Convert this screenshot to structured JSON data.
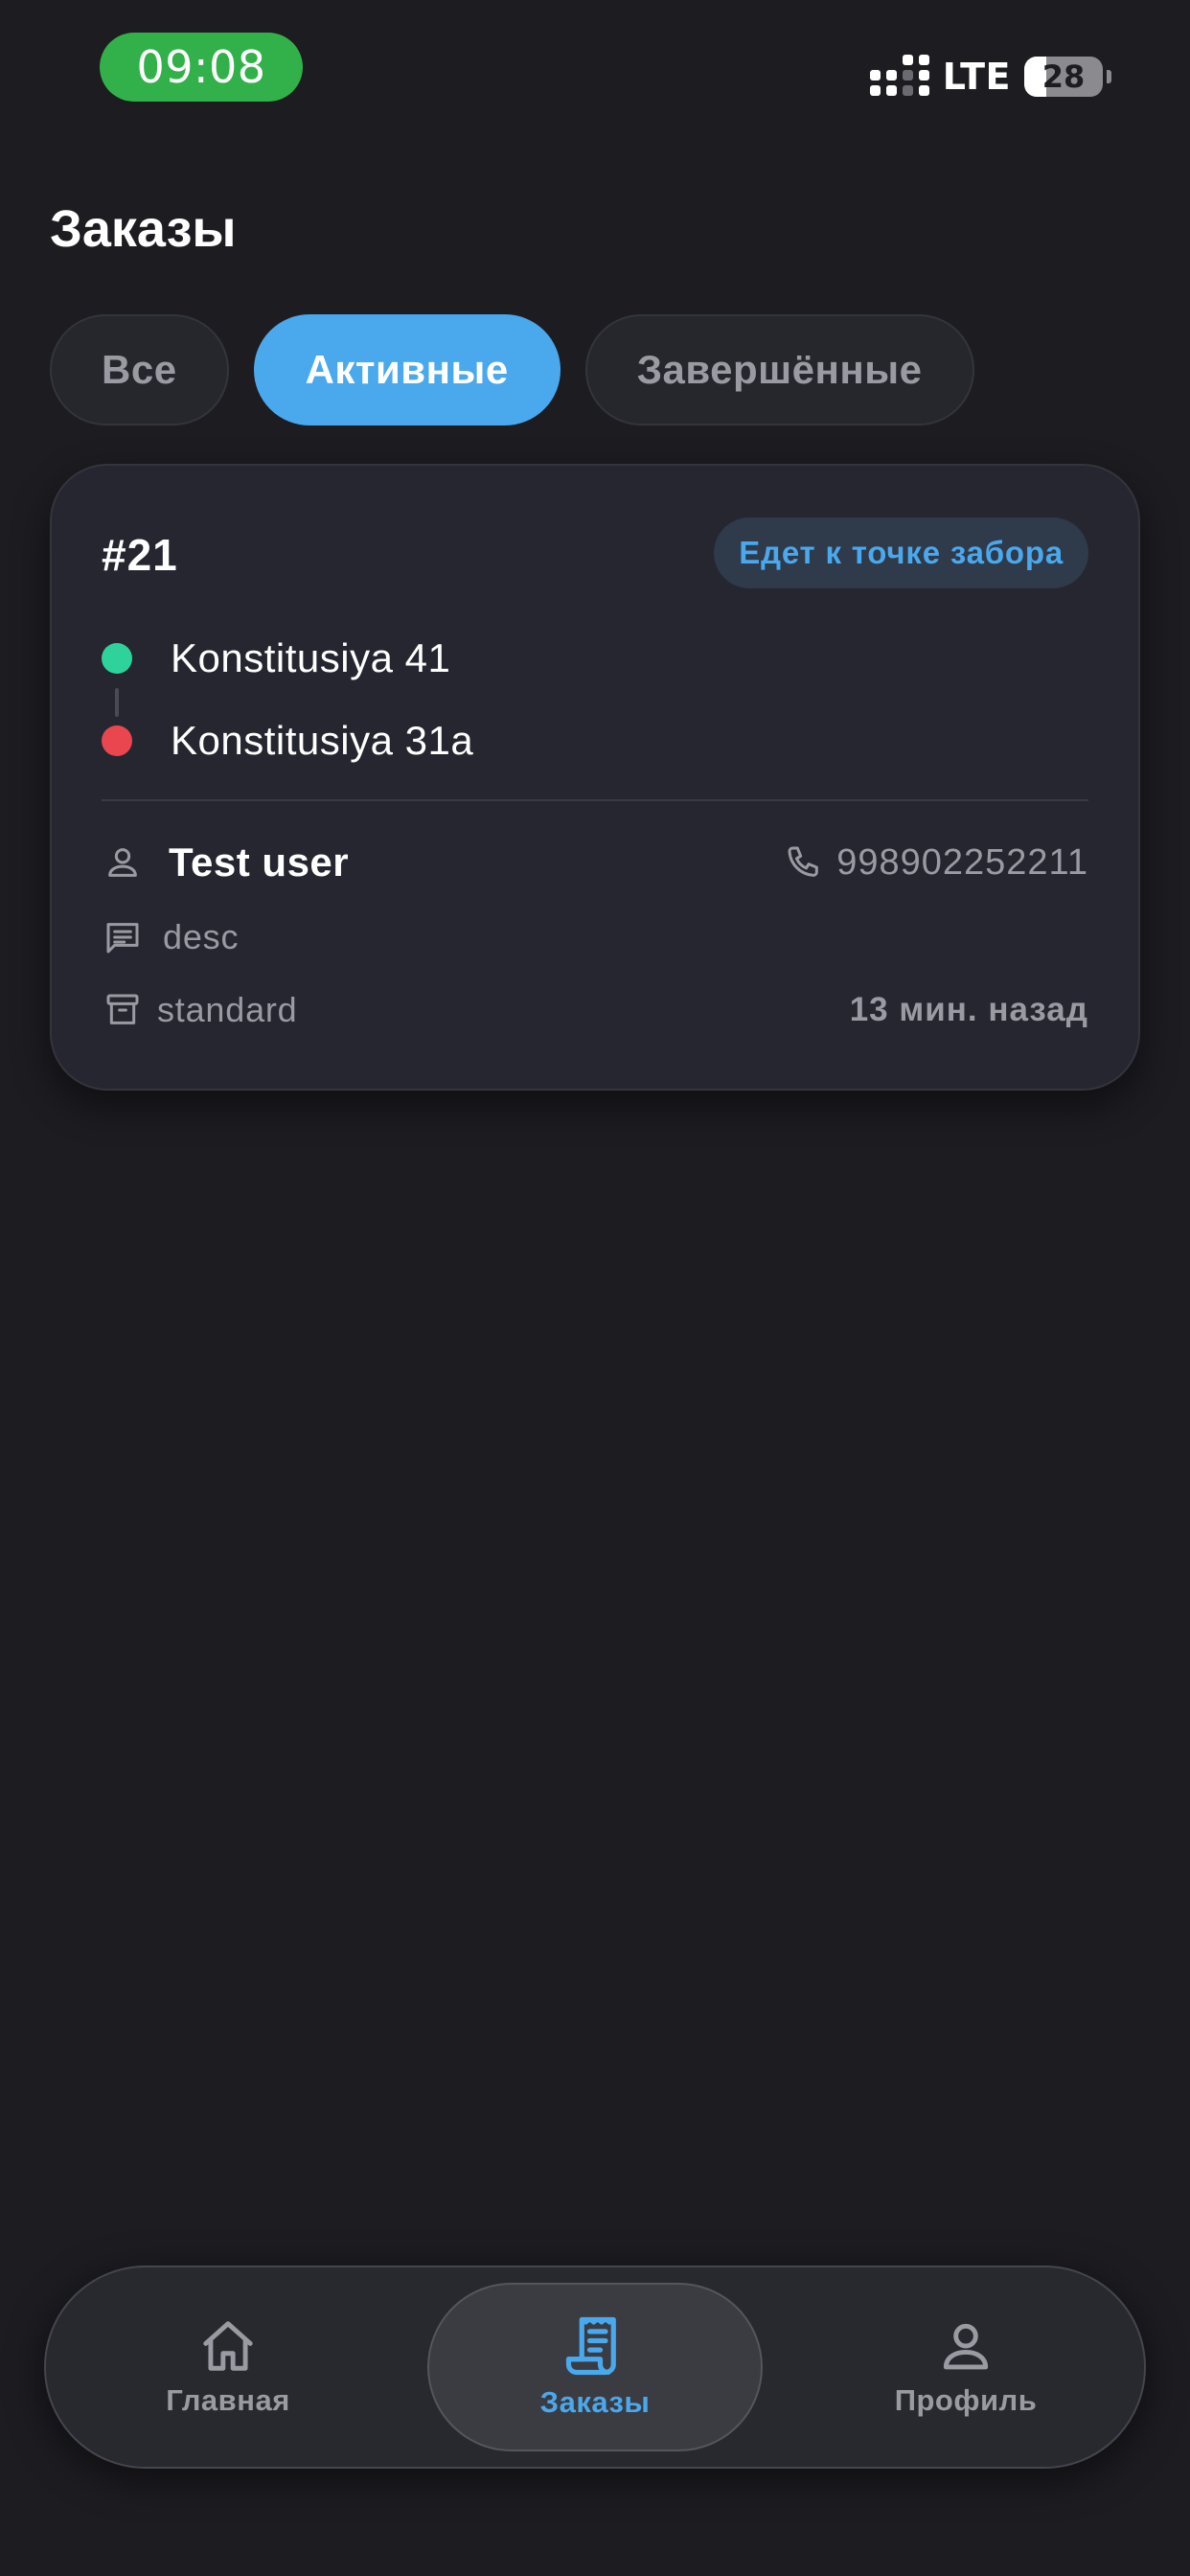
{
  "status_bar": {
    "time": "09:08",
    "network": "LTE",
    "battery": "28",
    "battery_level": 0.28
  },
  "header": {
    "title": "Заказы"
  },
  "tabs": [
    {
      "label": "Все",
      "active": false
    },
    {
      "label": "Активные",
      "active": true
    },
    {
      "label": "Завершённые",
      "active": false
    }
  ],
  "order": {
    "id": "#21",
    "status": "Едет к точке забора",
    "pickup": "Konstitusiya 41",
    "dropoff": "Konstitusiya 31a",
    "customer": "Test user",
    "phone": "998902252211",
    "description": "desc",
    "tariff": "standard",
    "time_ago": "13 мин. назад"
  },
  "bottom_nav": {
    "items": [
      {
        "label": "Главная",
        "icon": "home-icon",
        "active": false
      },
      {
        "label": "Заказы",
        "icon": "receipt-icon",
        "active": true
      },
      {
        "label": "Профиль",
        "icon": "person-icon",
        "active": false
      }
    ]
  },
  "colors": {
    "background": "#1c1c21",
    "accent": "#4aa8ec",
    "time_pill": "#32b14a",
    "pickup_dot": "#2ed39b",
    "dropoff_dot": "#e9464f"
  }
}
